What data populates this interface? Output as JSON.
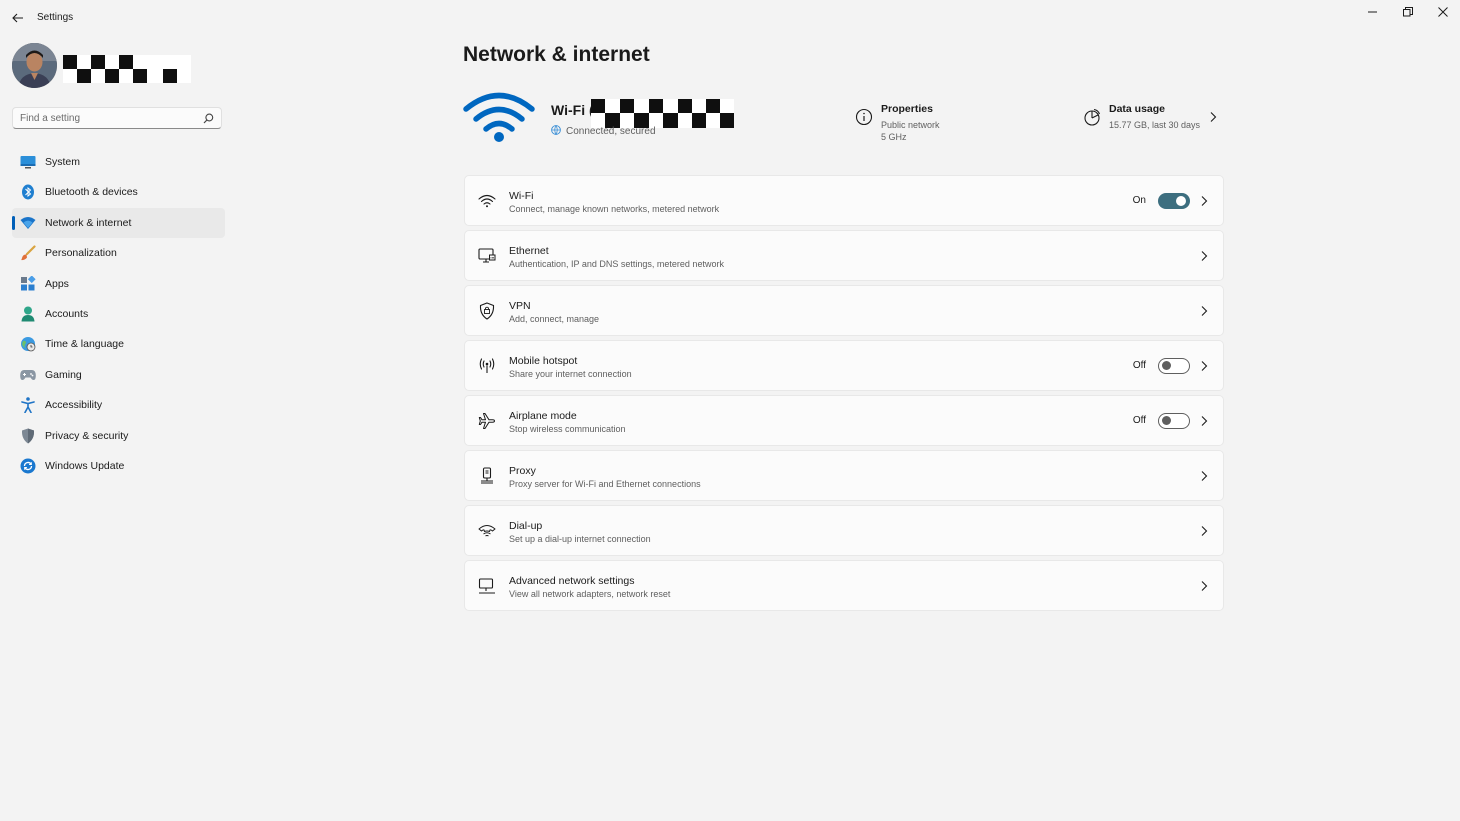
{
  "window": {
    "title": "Settings",
    "controls": [
      "minimize",
      "restore",
      "close"
    ]
  },
  "sidebar": {
    "search": {
      "placeholder": "Find a setting",
      "value": ""
    },
    "items": [
      {
        "label": "System",
        "icon": "monitor-icon"
      },
      {
        "label": "Bluetooth & devices",
        "icon": "bluetooth-icon"
      },
      {
        "label": "Network & internet",
        "icon": "wifi-icon",
        "active": true
      },
      {
        "label": "Personalization",
        "icon": "brush-icon"
      },
      {
        "label": "Apps",
        "icon": "apps-icon"
      },
      {
        "label": "Accounts",
        "icon": "person-icon"
      },
      {
        "label": "Time & language",
        "icon": "globe-clock-icon"
      },
      {
        "label": "Gaming",
        "icon": "gamepad-icon"
      },
      {
        "label": "Accessibility",
        "icon": "accessibility-icon"
      },
      {
        "label": "Privacy & security",
        "icon": "shield-icon"
      },
      {
        "label": "Windows Update",
        "icon": "update-icon"
      }
    ]
  },
  "main": {
    "title": "Network & internet",
    "connection": {
      "name_prefix": "Wi-Fi (",
      "status": "Connected, secured"
    },
    "properties": {
      "title": "Properties",
      "network_type": "Public network",
      "band": "5 GHz"
    },
    "data_usage": {
      "title": "Data usage",
      "summary": "15.77 GB, last 30 days"
    },
    "cards": [
      {
        "title": "Wi-Fi",
        "subtitle": "Connect, manage known networks, metered network",
        "icon": "wifi-icon",
        "state": "On"
      },
      {
        "title": "Ethernet",
        "subtitle": "Authentication, IP and DNS settings, metered network",
        "icon": "ethernet-icon"
      },
      {
        "title": "VPN",
        "subtitle": "Add, connect, manage",
        "icon": "vpn-shield-icon"
      },
      {
        "title": "Mobile hotspot",
        "subtitle": "Share your internet connection",
        "icon": "hotspot-icon",
        "state": "Off"
      },
      {
        "title": "Airplane mode",
        "subtitle": "Stop wireless communication",
        "icon": "airplane-icon",
        "state": "Off"
      },
      {
        "title": "Proxy",
        "subtitle": "Proxy server for Wi-Fi and Ethernet connections",
        "icon": "proxy-icon"
      },
      {
        "title": "Dial-up",
        "subtitle": "Set up a dial-up internet connection",
        "icon": "dialup-icon"
      },
      {
        "title": "Advanced network settings",
        "subtitle": "View all network adapters, network reset",
        "icon": "advanced-network-icon"
      }
    ]
  },
  "colors": {
    "accent": "#005fb8",
    "wifi_blue": "#0067c0",
    "toggle_on": "#3d6e7f",
    "background": "#f3f3f3",
    "card": "#fbfbfb"
  }
}
